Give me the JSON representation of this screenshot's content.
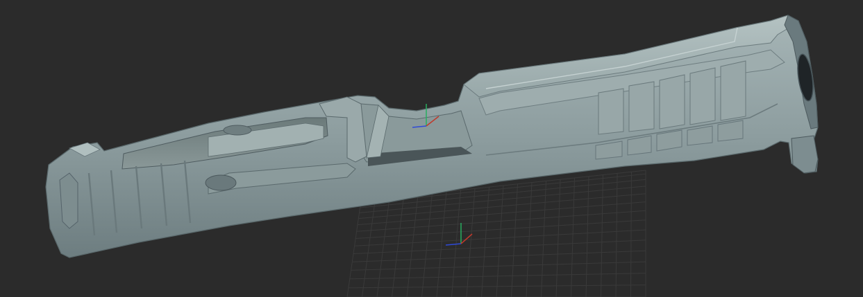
{
  "viewport": {
    "background": "#2b2b2b",
    "grid_color": "#3a3a3a",
    "model_color": "#8fa0a2",
    "model_highlight": "#a9b8b8",
    "model_shadow": "#5f6e72",
    "axis_x_color": "#c0392b",
    "axis_y_color": "#27ae60",
    "axis_z_color": "#2e4ad8"
  },
  "icons": {
    "model_gizmo": "xyz-axis-gizmo",
    "world_gizmo": "xyz-axis-gizmo"
  }
}
